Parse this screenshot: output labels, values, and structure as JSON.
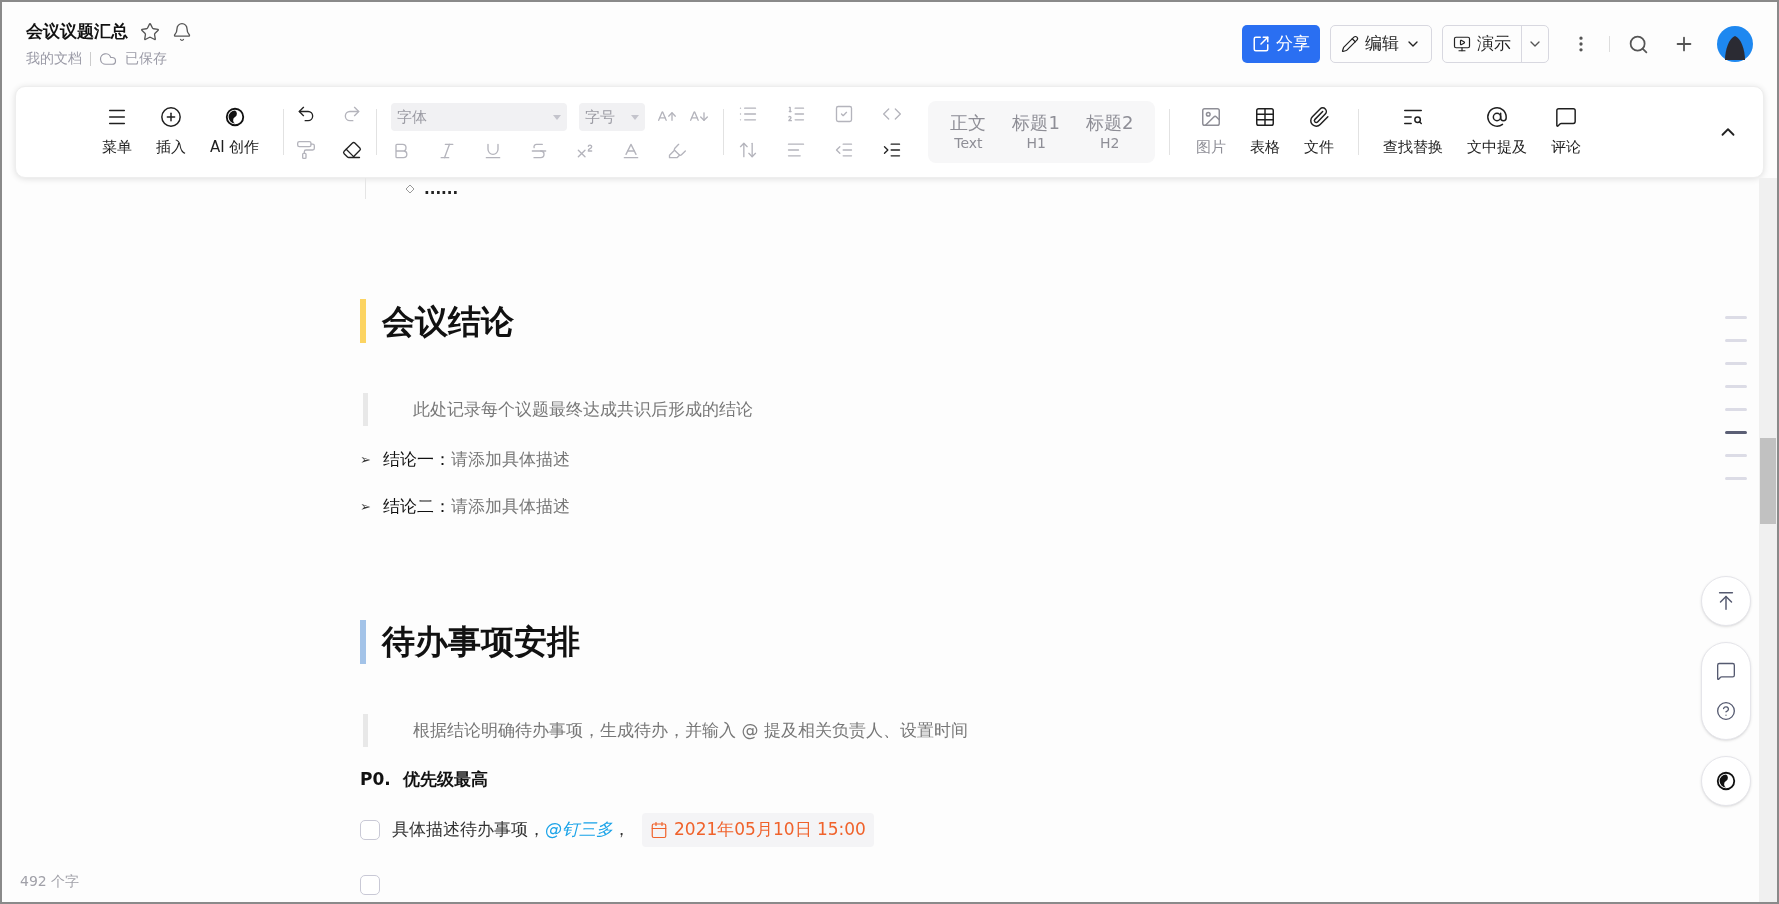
{
  "header": {
    "title": "会议议题汇总",
    "location": "我的文档",
    "save_status": "已保存"
  },
  "actions": {
    "share": "分享",
    "edit": "编辑",
    "present": "演示"
  },
  "toolbar": {
    "main": [
      {
        "label": "菜单",
        "kind": "menu"
      },
      {
        "label": "插入",
        "kind": "insert"
      },
      {
        "label": "AI 创作",
        "kind": "ai"
      }
    ],
    "font_placeholder": "字体",
    "size_placeholder": "字号",
    "styles": [
      {
        "label": "正文",
        "sub": "Text",
        "disabled": true
      },
      {
        "label": "标题1",
        "sub": "H1",
        "disabled": true
      },
      {
        "label": "标题2",
        "sub": "H2",
        "disabled": true
      }
    ],
    "insert": [
      {
        "label": "图片",
        "kind": "image",
        "disabled": true
      },
      {
        "label": "表格",
        "kind": "table",
        "disabled": false
      },
      {
        "label": "文件",
        "kind": "file",
        "disabled": false
      }
    ],
    "tools": [
      {
        "label": "查找替换",
        "kind": "find"
      },
      {
        "label": "文中提及",
        "kind": "mention"
      },
      {
        "label": "评论",
        "kind": "comment"
      }
    ]
  },
  "document": {
    "blocks": [
      {
        "kind": "list_tail",
        "text": "......"
      },
      {
        "kind": "heading",
        "text": "会议结论",
        "color": "#fcd462"
      },
      {
        "kind": "quote",
        "text": "此处记录每个议题最终达成共识后形成的结论"
      },
      {
        "kind": "bullet",
        "marker": "➢",
        "label": "结论一：",
        "text": "请添加具体描述"
      },
      {
        "kind": "bullet",
        "marker": "➢",
        "label": "结论二：",
        "text": "请添加具体描述"
      },
      {
        "kind": "heading",
        "text": "待办事项安排",
        "color": "#a3c3e8"
      },
      {
        "kind": "quote",
        "text": "根据结论明确待办事项，生成待办，并输入 @ 提及相关负责人、设置时间"
      },
      {
        "kind": "priority",
        "text": "P0.  优先级最高"
      },
      {
        "kind": "todo",
        "checked": false,
        "text": "具体描述待办事项，",
        "mention": "@钉三多",
        "after": "，",
        "date": "2021年05月10日 15:00"
      },
      {
        "kind": "todo",
        "checked": false
      }
    ]
  },
  "outline": [
    {
      "selected": false
    },
    {
      "selected": false
    },
    {
      "selected": false
    },
    {
      "selected": false
    },
    {
      "selected": false
    },
    {
      "selected": true
    },
    {
      "selected": false
    },
    {
      "selected": false
    }
  ],
  "word_count": "492 个字"
}
